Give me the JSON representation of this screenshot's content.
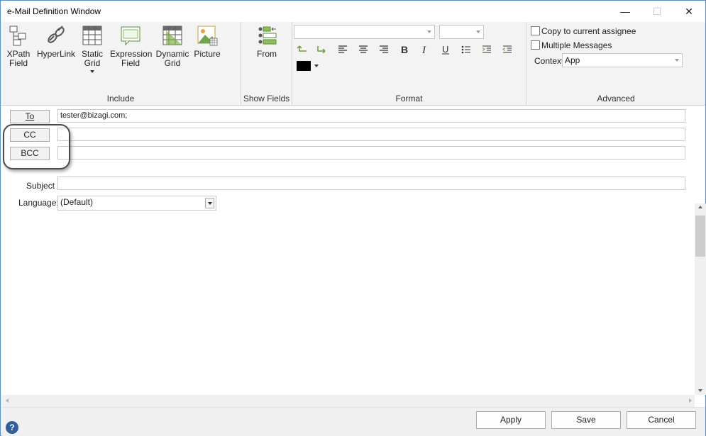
{
  "window": {
    "title": "e-Mail Definition Window",
    "minimize": "—",
    "maximize": "☐",
    "close": "✕"
  },
  "ribbon": {
    "include": {
      "label": "Include",
      "buttons": [
        {
          "line1": "XPath",
          "line2": "Field"
        },
        {
          "line1": "HyperLink",
          "line2": ""
        },
        {
          "line1": "Static",
          "line2": "Grid"
        },
        {
          "line1": "Expression",
          "line2": "Field"
        },
        {
          "line1": "Dynamic",
          "line2": "Grid"
        },
        {
          "line1": "Picture",
          "line2": ""
        }
      ]
    },
    "show_fields": {
      "label": "Show Fields",
      "from": "From"
    },
    "format": {
      "label": "Format",
      "font_value": "",
      "size_value": "",
      "color": "#000000"
    },
    "advanced": {
      "label": "Advanced",
      "copy_assignee": "Copy to current assignee",
      "multiple_messages": "Multiple Messages",
      "context_label": "Context",
      "context_value": "App"
    }
  },
  "form": {
    "to_label": "To",
    "to_value": "tester@bizagi.com;",
    "cc_label": "CC",
    "cc_value": "",
    "bcc_label": "BCC",
    "bcc_value": "",
    "subject_label": "Subject",
    "subject_value": "",
    "language_label": "Language:",
    "language_value": "(Default)"
  },
  "footer": {
    "apply": "Apply",
    "save": "Save",
    "cancel": "Cancel",
    "help": "?"
  }
}
